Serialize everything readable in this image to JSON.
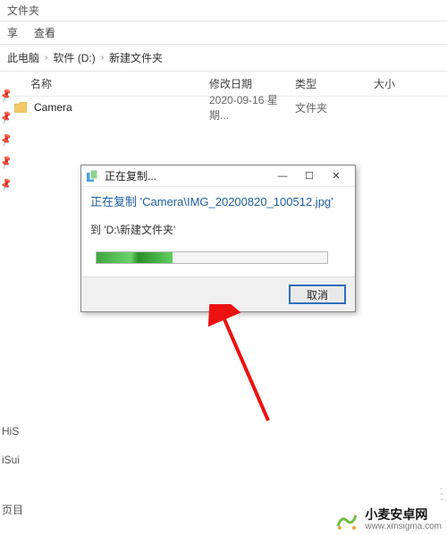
{
  "window": {
    "title": "文件夹"
  },
  "menu": {
    "share": "享",
    "view": "查看"
  },
  "breadcrumbs": {
    "root": "此电脑",
    "drive": "软件 (D:)",
    "folder": "新建文件夹"
  },
  "columns": {
    "name": "名称",
    "date": "修改日期",
    "type": "类型",
    "size": "大小"
  },
  "rows": [
    {
      "name": "Camera",
      "date": "2020-09-16 星期...",
      "type": "文件夹",
      "size": ""
    }
  ],
  "dialog": {
    "title": "正在复制...",
    "header_prefix": "正在复制 '",
    "header_path": "Camera\\IMG_20200820_100512.jpg",
    "header_suffix": "'",
    "dest_prefix": "到 '",
    "dest_path": "D:\\新建文件夹",
    "dest_suffix": "'",
    "progress_percent": 33,
    "cancel": "取消"
  },
  "sidebar_bottom": {
    "item1": "HiS",
    "item2": "iSui",
    "item3": "页目"
  },
  "watermark": {
    "title": "小麦安卓网",
    "url": "www.xmsigma.com"
  }
}
